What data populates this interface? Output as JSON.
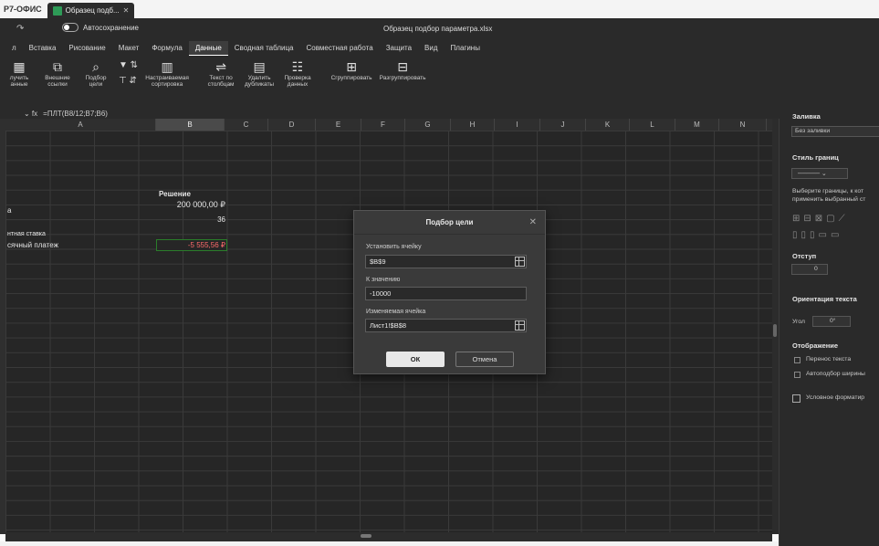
{
  "app": {
    "name": "Р7-ОФИС",
    "doc_tab": "Образец подб..."
  },
  "title_bar": {
    "autosave_label": "Автосохранение",
    "document_title": "Образец подбор параметра.xlsx"
  },
  "menu": [
    {
      "label": "л"
    },
    {
      "label": "Вставка"
    },
    {
      "label": "Рисование"
    },
    {
      "label": "Макет"
    },
    {
      "label": "Формула"
    },
    {
      "label": "Данные",
      "active": true
    },
    {
      "label": "Сводная таблица"
    },
    {
      "label": "Совместная работа"
    },
    {
      "label": "Защита"
    },
    {
      "label": "Вид"
    },
    {
      "label": "Плагины"
    }
  ],
  "ribbon": {
    "get_data": "лучить\nанные",
    "external_links": "Внешние\nссылки",
    "goal_seek": "Подбор\nцели",
    "custom_sort": "Настраиваемая\nсортировка",
    "text_to_columns": "Текст по\nстолбцам",
    "remove_duplicates": "Удалить\nдубликаты",
    "data_validation": "Проверка\nданных",
    "group": "Сгруппировать",
    "ungroup": "Разгруппировать"
  },
  "formula_bar": {
    "formula": "=ПЛТ(B8/12;B7;B6)"
  },
  "columns": [
    "A",
    "B",
    "C",
    "D",
    "E",
    "F",
    "G",
    "H",
    "I",
    "J",
    "K",
    "L",
    "M",
    "N"
  ],
  "cells": {
    "a_fragment": "а",
    "b_header": "Решение",
    "b_amount": "200 000,00 ₽",
    "b_term": "36",
    "a_rate": "нтная ставка",
    "a_payment": "сячный платеж",
    "b_payment": "-5 555,56 ₽"
  },
  "dialog": {
    "title": "Подбор цели",
    "set_cell_label": "Установить ячейку",
    "set_cell_value": "$B$9",
    "to_value_label": "К значению",
    "to_value_value": "-10000",
    "changing_cell_label": "Изменяемая ячейка",
    "changing_cell_value": "Лист1!$B$8",
    "ok": "ОК",
    "cancel": "Отмена"
  },
  "right_panel": {
    "fill_title": "Заливка",
    "fill_value": "Без заливки",
    "border_style_title": "Стиль границ",
    "border_hint_1": "Выберите границы, к кот",
    "border_hint_2": "применить выбранный ст",
    "indent_title": "Отступ",
    "indent_value": "0",
    "orientation_title": "Ориентация текста",
    "angle_label": "Угол",
    "angle_value": "0°",
    "display_title": "Отображение",
    "wrap_text": "Перенос текста",
    "autofit_width": "Автоподбор ширины",
    "conditional_format": "Условное форматир"
  },
  "colors": {
    "accent_green": "#2e9b57",
    "negative": "#ff6b6b",
    "chrome": "#2a2a2a"
  }
}
